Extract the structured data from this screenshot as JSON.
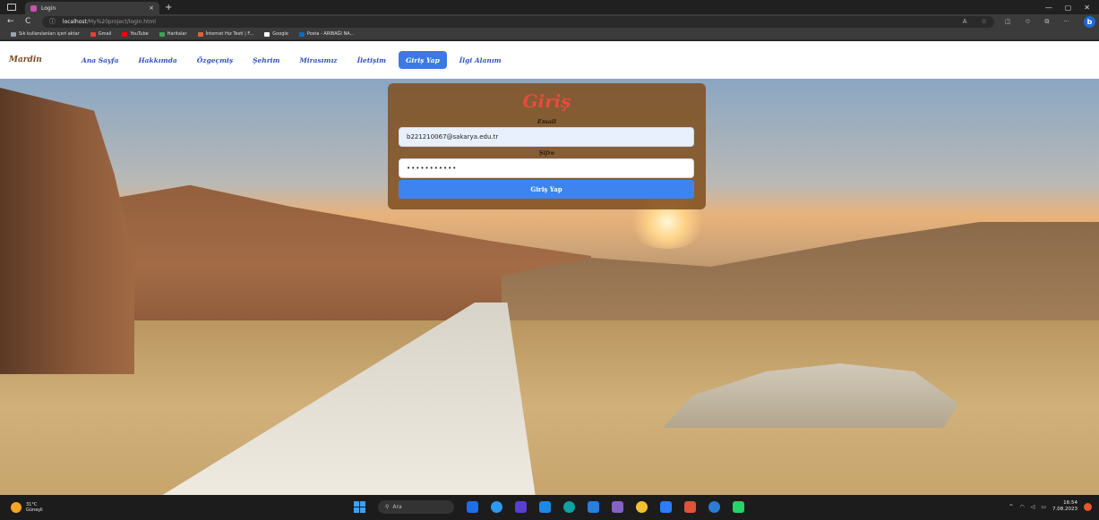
{
  "browser": {
    "tab_title": "Login",
    "tab_close": "×",
    "tab_new": "+",
    "window_controls": [
      "—",
      "▢",
      "✕"
    ],
    "url_host": "localhost",
    "url_path": "/My%20project/login.html",
    "back": "←",
    "refresh": "C",
    "info": "ⓘ",
    "more": "···",
    "bing": "b"
  },
  "bookmarks": [
    {
      "label": "Sık kullanılanları içeri aktar",
      "color": "#9aa3b0"
    },
    {
      "label": "Gmail",
      "color": "#e44134"
    },
    {
      "label": "YouTube",
      "color": "#ff0000"
    },
    {
      "label": "Haritalar",
      "color": "#34a853"
    },
    {
      "label": "İnternet Hız Testi | F...",
      "color": "#e7622a"
    },
    {
      "label": "Google",
      "color": "#ffffff"
    },
    {
      "label": "Posta - ARIBAĞI NA...",
      "color": "#0f6cbd"
    }
  ],
  "site": {
    "logo": "Mardin",
    "menu": [
      {
        "label": "Ana Sayfa",
        "active": false
      },
      {
        "label": "Hakkımda",
        "active": false
      },
      {
        "label": "Özgeçmiş",
        "active": false
      },
      {
        "label": "Şehrim",
        "active": false
      },
      {
        "label": "Mirasımız",
        "active": false
      },
      {
        "label": "İletişim",
        "active": false
      },
      {
        "label": "Giriş Yap",
        "active": true
      },
      {
        "label": "İlgi Alanım",
        "active": false
      }
    ]
  },
  "login": {
    "title": "Giriş",
    "email_label": "Email",
    "email_value": "b221210067@sakarya.edu.tr",
    "password_label": "Şifre",
    "password_value": "•••••••••••",
    "button_label": "Giriş Yap"
  },
  "taskbar": {
    "weather_temp": "31°C",
    "weather_desc": "Güneşli",
    "search_placeholder": "Ara",
    "time": "16:54",
    "date": "7.08.2023",
    "tray_chevron": "^",
    "apps": [
      "#1f6fe0",
      "#2c9af0",
      "#5b3fd1",
      "#1e88e5",
      "#0fa3a3",
      "#2a7de1",
      "#8661c5",
      "#f2c12e",
      "#2e7cf6",
      "#e0523a",
      "#2b7cd3",
      "#25d366"
    ]
  }
}
